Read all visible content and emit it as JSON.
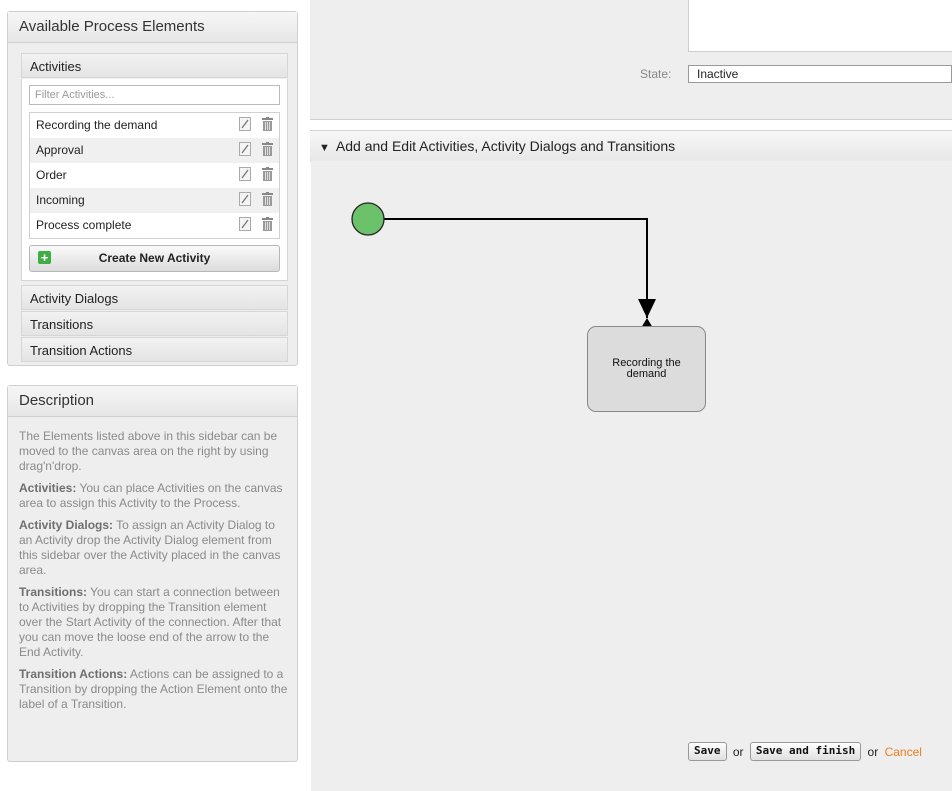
{
  "sidebar": {
    "elements_panel": {
      "title": "Available Process Elements",
      "activities": {
        "header": "Activities",
        "filter_placeholder": "Filter Activities...",
        "items": [
          {
            "label": "Recording the demand"
          },
          {
            "label": "Approval"
          },
          {
            "label": "Order"
          },
          {
            "label": "Incoming"
          },
          {
            "label": "Process complete"
          }
        ],
        "edit_icon": "pencil-icon",
        "delete_icon": "trash-icon",
        "create_button": "Create New Activity",
        "create_icon": "plus-icon"
      },
      "sections": [
        "Activity Dialogs",
        "Transitions",
        "Transition Actions"
      ]
    },
    "description_panel": {
      "title": "Description",
      "intro": "The Elements listed above in this sidebar can be moved to the canvas area on the right by using drag'n'drop.",
      "items": [
        {
          "term": "Activities:",
          "text": " You can place Activities on the canvas area to assign this Activity to the Process."
        },
        {
          "term": "Activity Dialogs:",
          "text": " To assign an Activity Dialog to an Activity drop the Activity Dialog element from this sidebar over the Activity placed in the canvas area."
        },
        {
          "term": "Transitions:",
          "text": " You can start a connection between to Activities by dropping the Transition element over the Start Activity of the connection. After that you can move the loose end of the arrow to the End Activity."
        },
        {
          "term": "Transition Actions:",
          "text": " Actions can be assigned to a Transition by dropping the Action Element onto the label of a Transition."
        }
      ]
    }
  },
  "process_form": {
    "state_label": "State:",
    "state_value": "Inactive"
  },
  "canvas_section": {
    "header": "Add and Edit Activities, Activity Dialogs and Transitions",
    "toggle_icon": "triangle-down-icon",
    "start_node_color": "#6cc26a",
    "activity_node_label": "Recording the demand"
  },
  "actions": {
    "save": "Save",
    "or1": "or",
    "save_finish": "Save and finish",
    "or2": "or",
    "cancel": "Cancel",
    "cancel_color": "#f07d1f"
  }
}
